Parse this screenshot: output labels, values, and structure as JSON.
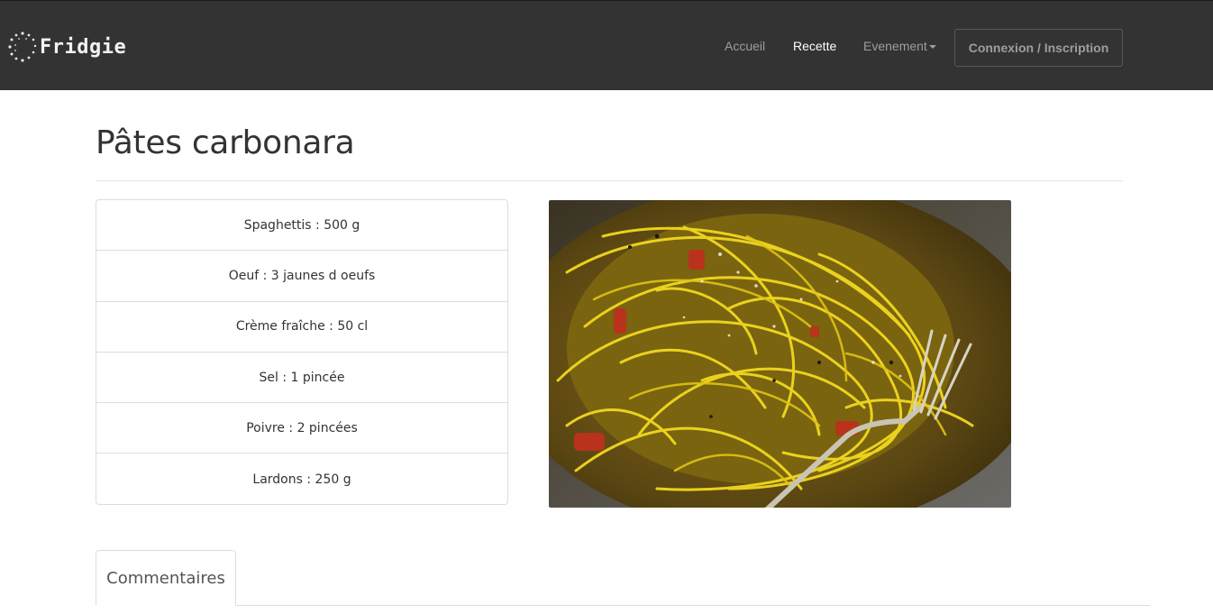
{
  "navbar": {
    "brand": "Fridgie",
    "links": {
      "home": "Accueil",
      "recipe": "Recette",
      "event": "Evenement"
    },
    "login_button": "Connexion / Inscription"
  },
  "recipe": {
    "title": "Pâtes carbonara",
    "ingredients": [
      "Spaghettis : 500 g",
      "Oeuf : 3 jaunes d oeufs",
      "Crème fraîche : 50 cl",
      "Sel : 1 pincée",
      "Poivre : 2 pincées",
      "Lardons : 250 g"
    ]
  },
  "tabs": {
    "comments": "Commentaires"
  },
  "colors": {
    "navbar_bg": "#333333",
    "nav_link": "#9d9d9d",
    "nav_active": "#ffffff",
    "border": "#dddddd"
  }
}
